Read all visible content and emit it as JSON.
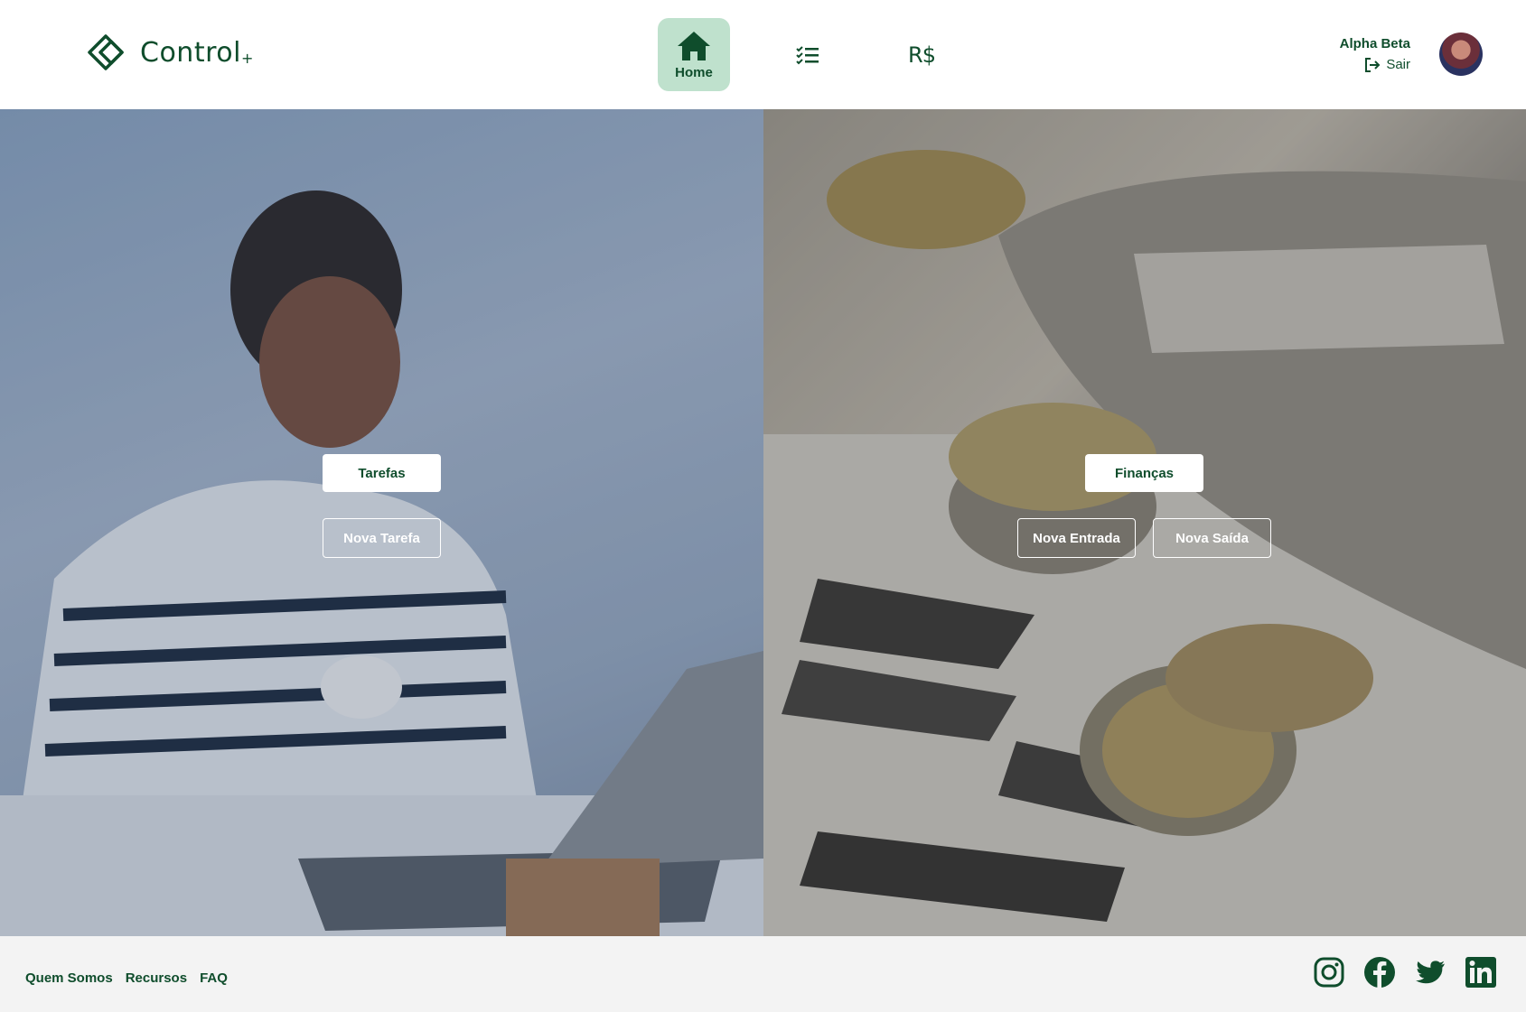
{
  "brand": {
    "name": "Control",
    "suffix": "+"
  },
  "nav": {
    "home_label": "Home",
    "finance_glyph": "R$"
  },
  "user": {
    "name": "Alpha Beta",
    "logout_label": "Sair"
  },
  "tasks": {
    "title": "Tarefas",
    "new_task": "Nova Tarefa"
  },
  "finance": {
    "title": "Finanças",
    "new_income": "Nova Entrada",
    "new_expense": "Nova Saída"
  },
  "footer": {
    "links": [
      "Quem Somos",
      "Recursos",
      "FAQ"
    ],
    "social": [
      "instagram-icon",
      "facebook-icon",
      "twitter-icon",
      "linkedin-icon"
    ]
  },
  "colors": {
    "accent": "#0f4d2c",
    "active_nav_bg": "#bfe1cd",
    "footer_bg": "#f3f3f3"
  }
}
